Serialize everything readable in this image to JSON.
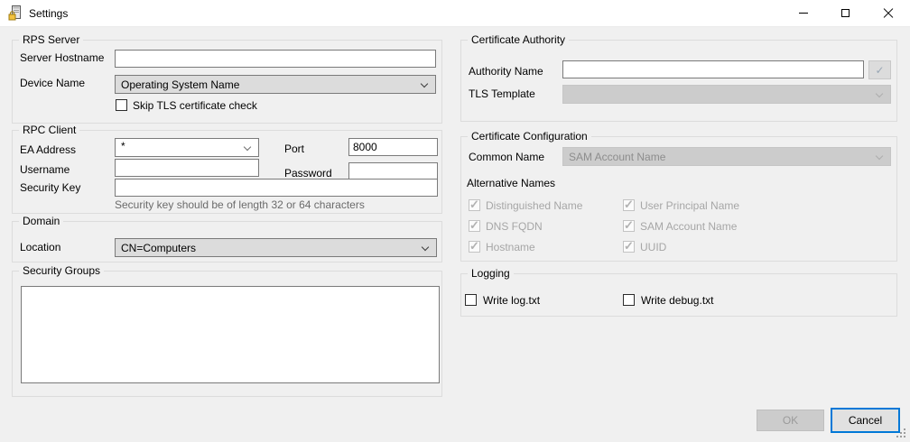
{
  "window": {
    "title": "Settings"
  },
  "appearance": {
    "accent_color": "#0078d7",
    "titlebar_bg": "#ffffff",
    "dialog_bg": "#f0f0f0",
    "disabled_text": "#a6a6a6"
  },
  "icons": {
    "check_glyph": "✓"
  },
  "groups": {
    "rps_server": {
      "title": "RPS Server",
      "server_hostname_label": "Server Hostname",
      "server_hostname_value": "",
      "device_name_label": "Device Name",
      "device_name_value": "Operating System Name",
      "skip_tls_label": "Skip TLS certificate check",
      "skip_tls_checked": false
    },
    "rpc_client": {
      "title": "RPC Client",
      "ea_address_label": "EA Address",
      "ea_address_value": "*",
      "port_label": "Port",
      "port_value": "8000",
      "username_label": "Username",
      "username_value": "",
      "password_label": "Password",
      "password_value": "",
      "security_key_label": "Security Key",
      "security_key_value": "",
      "security_key_hint": "Security key should be of length 32 or 64 characters"
    },
    "domain": {
      "title": "Domain",
      "location_label": "Location",
      "location_value": "CN=Computers"
    },
    "security_groups": {
      "title": "Security Groups",
      "items": []
    },
    "certificate_authority": {
      "title": "Certificate Authority",
      "authority_name_label": "Authority Name",
      "authority_name_value": "",
      "tls_template_label": "TLS Template",
      "tls_template_value": ""
    },
    "certificate_configuration": {
      "title": "Certificate Configuration",
      "common_name_label": "Common Name",
      "common_name_value": "SAM Account Name",
      "alternative_names_label": "Alternative Names",
      "alt_names": [
        "Distinguished Name",
        "User Principal Name",
        "DNS FQDN",
        "SAM Account Name",
        "Hostname",
        "UUID"
      ],
      "alt_names_checked": [
        true,
        true,
        true,
        true,
        true,
        true
      ]
    },
    "logging": {
      "title": "Logging",
      "write_log_label": "Write log.txt",
      "write_log_checked": false,
      "write_debug_label": "Write debug.txt",
      "write_debug_checked": false
    }
  },
  "footer": {
    "ok_label": "OK",
    "cancel_label": "Cancel"
  }
}
